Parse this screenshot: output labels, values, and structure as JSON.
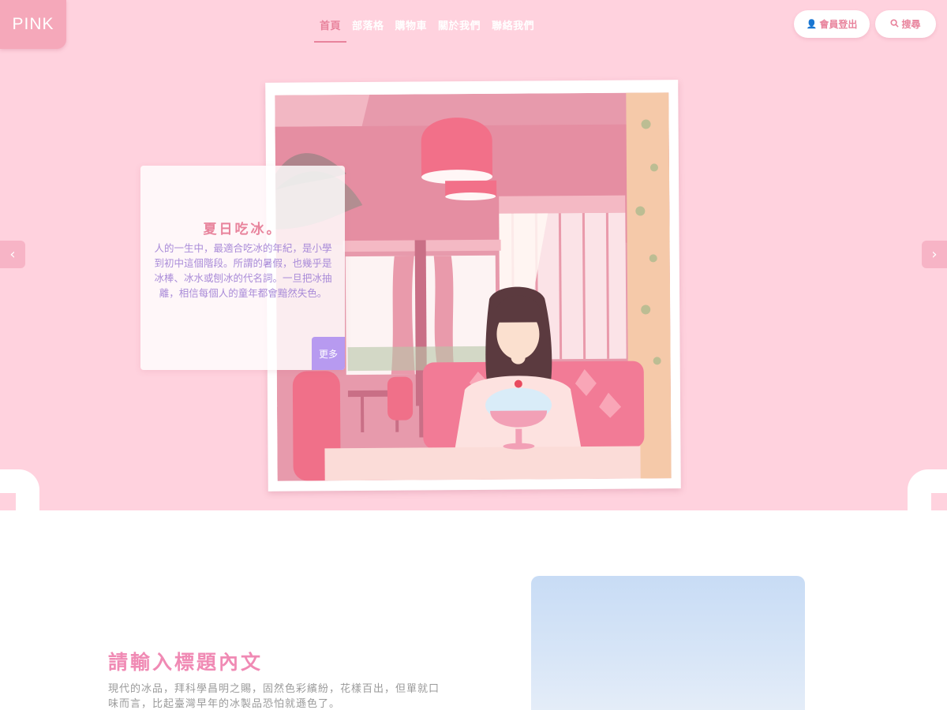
{
  "brand": {
    "logo_text": "PINK"
  },
  "nav": {
    "items": [
      {
        "label": "首頁",
        "active": true
      },
      {
        "label": "部落格"
      },
      {
        "label": "購物車"
      },
      {
        "label": "關於我們"
      },
      {
        "label": "聯絡我們"
      }
    ]
  },
  "header_actions": {
    "login_label": "會員登出",
    "login_icon": "user-icon",
    "search_label": "搜尋",
    "search_icon": "search-icon"
  },
  "hero": {
    "card_title": "夏日吃冰。",
    "card_text": "人的一生中，最適合吃冰的年紀，是小學到初中這個階段。所謂的暑假，也幾乎是冰棒、冰水或刨冰的代名詞。一旦把冰抽離，相信每個人的童年都會黯然失色。",
    "more_label": "更多",
    "prev_icon": "chevron-left-icon",
    "next_icon": "chevron-right-icon"
  },
  "section": {
    "title": "請輸入標題內文",
    "text": "現代的冰品，拜科學昌明之賜，固然色彩繽紛，花樣百出，但單就口味而言，比起臺灣早年的冰製品恐怕就遜色了。"
  },
  "colors": {
    "hero_bg": "#ffd2de",
    "accent_pink": "#e8839c",
    "title_pink": "#f08ab4",
    "lavender": "#b79af0",
    "card_text": "#a98bd8"
  }
}
